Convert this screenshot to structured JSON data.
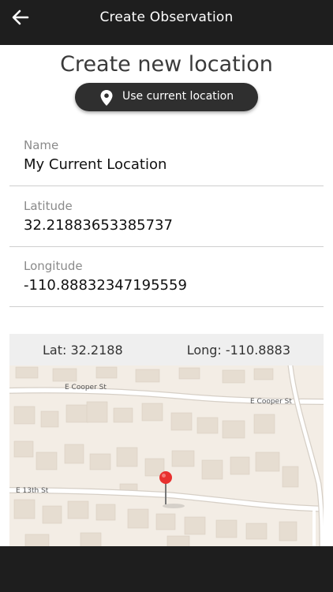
{
  "header": {
    "title": "Create Observation",
    "back_icon": "arrow-left-icon"
  },
  "page": {
    "title": "Create new location"
  },
  "location_button": {
    "label": "Use current location",
    "icon": "map-pin-icon"
  },
  "fields": {
    "name": {
      "label": "Name",
      "value": "My Current Location"
    },
    "latitude": {
      "label": "Latitude",
      "value": "32.21883653385737"
    },
    "longitude": {
      "label": "Longitude",
      "value": "-110.88832347195559"
    }
  },
  "map": {
    "lat_text": "Lat: 32.2188",
    "long_text": "Long: -110.8883",
    "streets": [
      "E Cooper St",
      "E Cooper St",
      "E 13th St"
    ],
    "marker_color": "#e8312f"
  },
  "colors": {
    "bar": "#1e1e1e",
    "button": "#2f2f2f",
    "map_bg": "#f3ede5"
  }
}
